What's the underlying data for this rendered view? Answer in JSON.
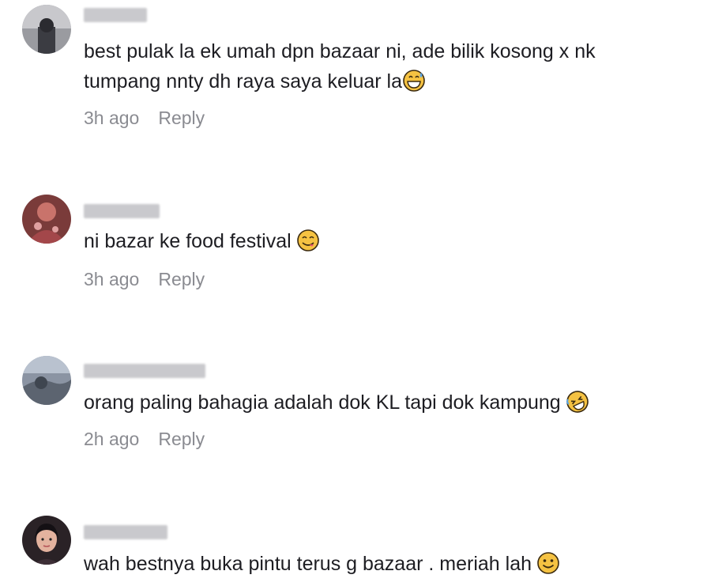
{
  "comments": [
    {
      "text": "best pulak la ek umah dpn bazaar ni, ade bilik kosong x nk\ntumpang nnty dh raya saya keluar la",
      "emoji": "grinning-sweat-emoji",
      "time": "3h ago",
      "reply_label": "Reply"
    },
    {
      "text": "ni bazar ke food festival",
      "emoji": "yum-face-emoji",
      "time": "3h ago",
      "reply_label": "Reply"
    },
    {
      "text": "orang paling bahagia adalah dok KL tapi dok kampung",
      "emoji": "rolling-laughing-emoji",
      "time": "2h ago",
      "reply_label": "Reply"
    },
    {
      "text": "wah bestnya buka pintu terus g bazaar . meriah lah",
      "emoji": "smiling-face-emoji",
      "time": "",
      "reply_label": ""
    }
  ],
  "colors": {
    "text": "#1d1d22",
    "meta": "#8a8b91",
    "emoji_face": "#f5c242",
    "emoji_outline": "#3a2a10"
  }
}
